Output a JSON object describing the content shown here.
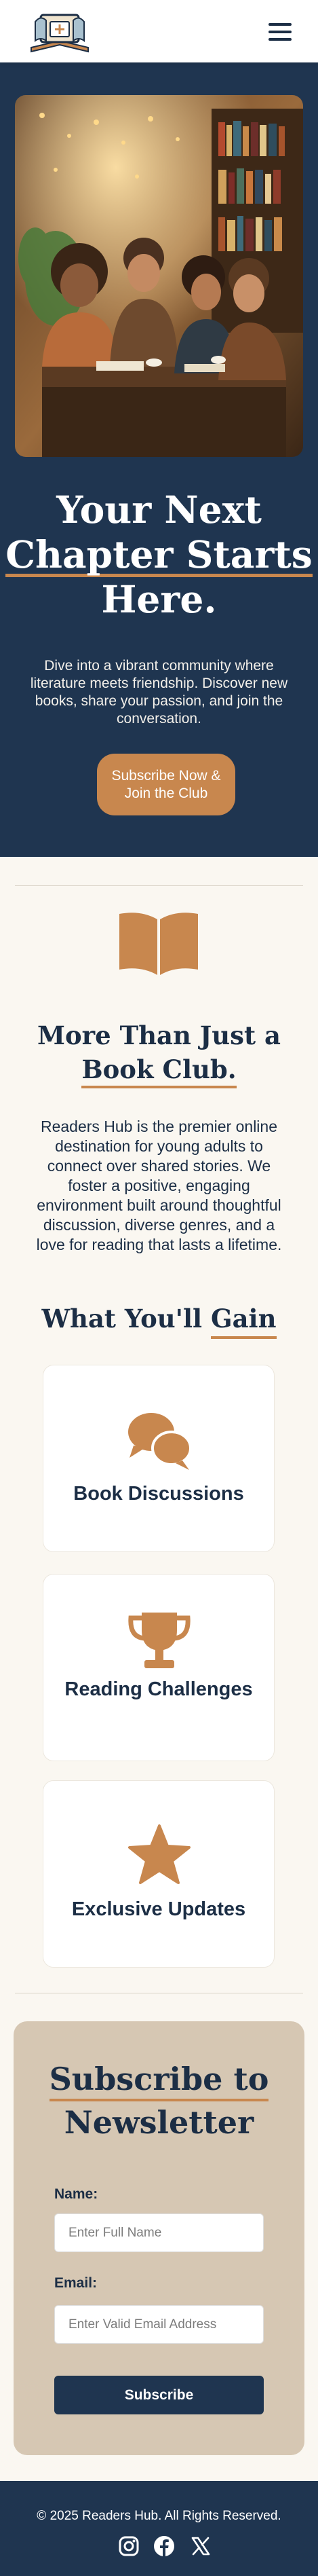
{
  "header": {
    "logo_icon": "readers-hub-logo-icon",
    "menu_icon": "hamburger-menu-icon"
  },
  "hero": {
    "image_alt": "Friends laughing over coffee and books in a cozy library cafe",
    "title_line1": "Your Next",
    "title_line2": "Chapter Starts",
    "title_line3": "Here.",
    "description": "Dive into a vibrant community where literature meets friendship. Discover new books, share your passion, and join the conversation.",
    "cta_label": "Subscribe Now & Join the Club"
  },
  "about": {
    "icon": "open-book-icon",
    "title_line1": "More Than Just a",
    "title_line2": "Book Club.",
    "text": "Readers Hub is the premier online destination for young adults to connect over shared stories. We foster a positive, engaging environment built around thoughtful discussion, diverse genres, and a love for reading that lasts a lifetime."
  },
  "gain": {
    "title_prefix": "What You'll ",
    "title_underlined": "Gain",
    "cards": [
      {
        "icon": "chat-bubbles-icon",
        "label": "Book Discussions"
      },
      {
        "icon": "trophy-icon",
        "label": "Reading Challenges"
      },
      {
        "icon": "star-icon",
        "label": "Exclusive Updates"
      }
    ]
  },
  "newsletter": {
    "title_line1": "Subscribe to",
    "title_line2": "Newsletter",
    "name_label": "Name:",
    "name_placeholder": "Enter Full Name",
    "email_label": "Email:",
    "email_placeholder": "Enter Valid Email Address",
    "submit_label": "Subscribe"
  },
  "footer": {
    "copyright": "© 2025 Readers Hub. All Rights Reserved.",
    "social": [
      "instagram-icon",
      "facebook-icon",
      "x-icon"
    ]
  },
  "colors": {
    "navy": "#1f3550",
    "accent": "#c8874e",
    "cream": "#faf7f1",
    "tan": "#d6c7b3"
  }
}
